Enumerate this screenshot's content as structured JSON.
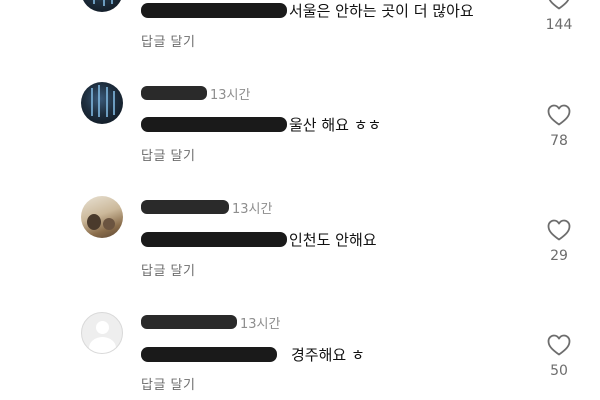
{
  "comments": [
    {
      "text": "서울은 안하는 곳이 더 많아요",
      "reply_label": "답글 달기",
      "like_count": "144"
    },
    {
      "time": "13시간",
      "text": "울산 해요 ㅎㅎ",
      "reply_label": "답글 달기",
      "like_count": "78"
    },
    {
      "time": "13시간",
      "text": "인천도 안해요",
      "reply_label": "답글 달기",
      "like_count": "29"
    },
    {
      "time": "13시간",
      "text": "경주해요 ㅎ",
      "reply_label": "답글 달기",
      "like_count": "50"
    }
  ],
  "icons": {
    "like": "heart-outline-icon",
    "avatar_default": "default-avatar-icon"
  },
  "colors": {
    "text": "#111111",
    "secondary": "#6d6d6d",
    "timestamp": "#8e8e8e",
    "redaction": "#1a1a1a"
  }
}
